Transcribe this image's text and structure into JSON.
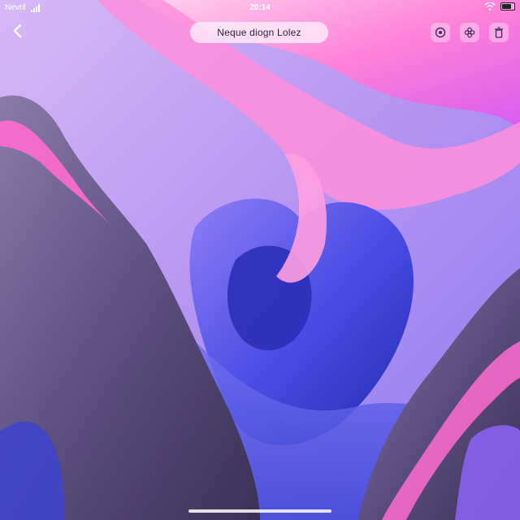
{
  "status_bar": {
    "carrier": "Nevril",
    "time": "20:14",
    "battery_level": 0.8
  },
  "header": {
    "title": "Neque diogn Lolez",
    "back_icon": "chevron-left-icon",
    "actions": [
      {
        "icon": "circle-dot-icon"
      },
      {
        "icon": "flower-icon"
      },
      {
        "icon": "trash-icon"
      }
    ]
  },
  "colors": {
    "sky": "#c9a6f2",
    "pink": "#ff7ad6",
    "blue": "#4c4fe0",
    "deep_blue": "#2a2fb8",
    "rock": "#6a5b86",
    "rock_dark": "#3f3657"
  }
}
